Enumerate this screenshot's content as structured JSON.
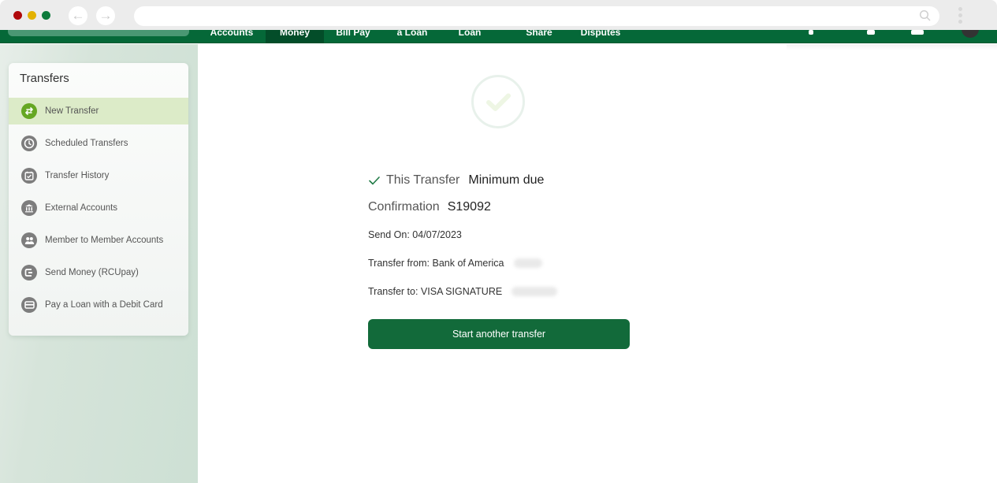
{
  "browser": {
    "back_icon": "←",
    "forward_icon": "→",
    "address_value": ""
  },
  "site_nav": {
    "tabs": [
      {
        "label": "Accounts",
        "active": false
      },
      {
        "label": "Money",
        "active": true
      },
      {
        "label": "Bill Pay",
        "active": false
      },
      {
        "label": "a Loan",
        "active": false
      },
      {
        "label": "Loan",
        "active": false
      },
      {
        "label": "Share",
        "active": false
      },
      {
        "label": "Disputes",
        "active": false
      }
    ]
  },
  "sidebar": {
    "title": "Transfers",
    "items": [
      {
        "label": "New Transfer",
        "icon": "transfer-arrows-icon",
        "active": true
      },
      {
        "label": "Scheduled Transfers",
        "icon": "clock-icon",
        "active": false
      },
      {
        "label": "Transfer History",
        "icon": "calendar-check-icon",
        "active": false
      },
      {
        "label": "External Accounts",
        "icon": "bank-icon",
        "active": false
      },
      {
        "label": "Member to Member Accounts",
        "icon": "people-icon",
        "active": false
      },
      {
        "label": "Send Money (RCUpay)",
        "icon": "send-money-icon",
        "active": false
      },
      {
        "label": "Pay a Loan with a Debit Card",
        "icon": "card-icon",
        "active": false
      }
    ]
  },
  "confirmation": {
    "this_transfer_label": "This Transfer",
    "this_transfer_value": "Minimum due",
    "confirmation_label": "Confirmation",
    "confirmation_value": "S19092",
    "send_on": "Send On: 04/07/2023",
    "transfer_from": "Transfer from: Bank of America",
    "transfer_to": "Transfer to: VISA SIGNATURE",
    "start_another_label": "Start another transfer"
  },
  "colors": {
    "brand_green": "#056838",
    "active_tab": "#034d29",
    "button_green": "#126a3a",
    "active_item_bg": "#dcebc8",
    "active_icon": "#65a723"
  }
}
